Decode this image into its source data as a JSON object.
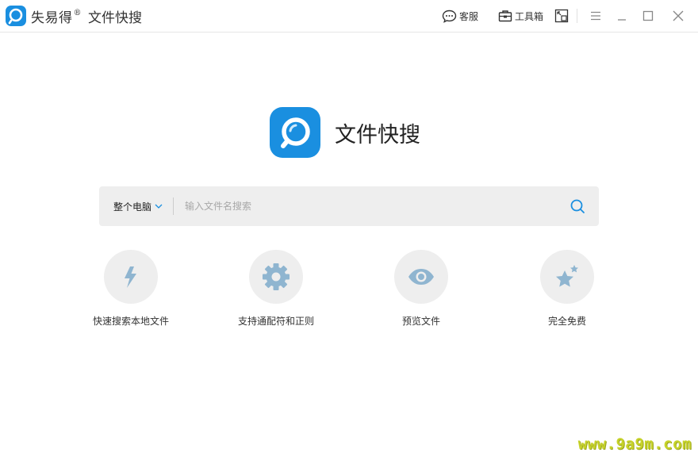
{
  "app": {
    "name": "失易得",
    "registered_mark": "®",
    "subtitle": "文件快搜"
  },
  "toolbar": {
    "service_label": "客服",
    "toolbox_label": "工具箱"
  },
  "hero": {
    "title": "文件快搜"
  },
  "search": {
    "scope_selected": "整个电脑",
    "placeholder": "输入文件名搜索",
    "value": ""
  },
  "features": [
    {
      "icon": "lightning-icon",
      "label": "快速搜索本地文件"
    },
    {
      "icon": "gear-icon",
      "label": "支持通配符和正则"
    },
    {
      "icon": "eye-icon",
      "label": "预览文件"
    },
    {
      "icon": "star-icon",
      "label": "完全免费"
    }
  ],
  "watermark": "www.9a9m.com",
  "colors": {
    "brand_blue": "#1a8fe0",
    "feature_icon": "#8fb5d0",
    "search_bg": "#eeeeee",
    "watermark": "#c7d32a"
  }
}
